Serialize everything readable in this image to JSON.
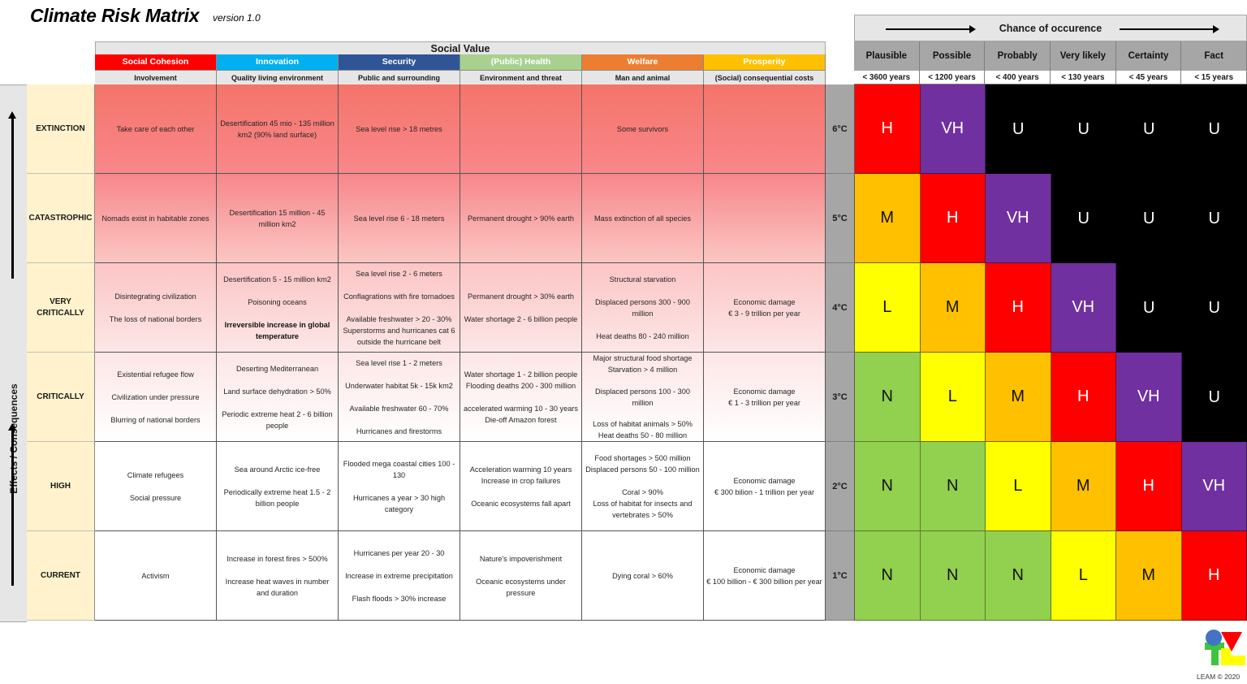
{
  "header": {
    "title": "Climate Risk Matrix",
    "version": "version 1.0"
  },
  "social_value": {
    "title": "Social Value",
    "categories": [
      {
        "label": "Social Cohesion",
        "subtitle": "Involvement",
        "color": "#ff0000"
      },
      {
        "label": "Innovation",
        "subtitle": "Quality living environment",
        "color": "#00b0f0"
      },
      {
        "label": "Security",
        "subtitle": "Public and surrounding",
        "color": "#2f5597"
      },
      {
        "label": "(Public) Health",
        "subtitle": "Environment and threat",
        "color": "#a9d08e"
      },
      {
        "label": "Welfare",
        "subtitle": "Man and animal",
        "color": "#ed7d31"
      },
      {
        "label": "Prosperity",
        "subtitle": "(Social) consequential costs",
        "color": "#ffc000"
      }
    ]
  },
  "axis": {
    "label": "Effects / Consequences"
  },
  "levels": [
    "EXTINCTION",
    "CATASTROPHIC",
    "VERY CRITICALLY",
    "CRITICALLY",
    "HIGH",
    "CURRENT"
  ],
  "temperatures": [
    "6°C",
    "5°C",
    "4°C",
    "3°C",
    "2°C",
    "1°C"
  ],
  "effects": [
    [
      [
        [
          "Take care of each other"
        ]
      ],
      [
        [
          "Desertification 45 mio - 135 million km2 (90% land surface)"
        ]
      ],
      [
        [
          "Sea level rise > 18 metres"
        ]
      ],
      [],
      [
        [
          "Some survivors"
        ]
      ],
      []
    ],
    [
      [
        [
          "Nomads exist in habitable zones"
        ]
      ],
      [
        [
          "Desertification 15 million - 45 million km2"
        ]
      ],
      [
        [
          "Sea level rise 6 - 18 meters"
        ]
      ],
      [
        [
          "Permanent drought > 90% earth"
        ]
      ],
      [
        [
          "Mass extinction of all species"
        ]
      ],
      []
    ],
    [
      [
        [
          "Disintegrating civilization"
        ],
        [
          "The loss of national borders"
        ]
      ],
      [
        [
          "Desertification 5 - 15 million km2"
        ],
        [
          "Poisoning oceans"
        ],
        [
          "Irreversible increase in global temperature",
          "bold"
        ]
      ],
      [
        [
          "Sea level rise 2 - 6 meters"
        ],
        [
          "Conflagrations with fire tornadoes"
        ],
        [
          "Available freshwater > 20 - 30%",
          "",
          "Superstorms and hurricanes cat 6 outside the hurricane belt"
        ]
      ],
      [
        [
          "Permanent drought > 30% earth"
        ],
        [
          "Water shortage 2 - 6 billion people"
        ]
      ],
      [
        [
          "Structural starvation"
        ],
        [
          "Displaced persons 300 - 900 million"
        ],
        [
          "Heat deaths 80 - 240 million"
        ]
      ],
      [
        [
          "Economic damage",
          "",
          "€ 3 - 9 trillion per year"
        ]
      ]
    ],
    [
      [
        [
          "Existential refugee flow"
        ],
        [
          "Civilization under pressure"
        ],
        [
          "Blurring of national borders"
        ]
      ],
      [
        [
          "Deserting Mediterranean"
        ],
        [
          "Land surface dehydration > 50%"
        ],
        [
          "Periodic extreme heat 2 - 6 billion people"
        ]
      ],
      [
        [
          "Sea level rise 1 - 2 meters"
        ],
        [
          "Underwater habitat 5k - 15k km2"
        ],
        [
          "Available freshwater 60 - 70%"
        ],
        [
          "Hurricanes and firestorms"
        ]
      ],
      [
        [
          "Water shortage 1 - 2 billion people",
          "",
          "Flooding deaths 200 - 300 million"
        ],
        [
          "accelerated warming 10 - 30 years",
          "",
          "Die-off Amazon forest"
        ]
      ],
      [
        [
          "Major structural food shortage",
          "",
          "Starvation > 4 million"
        ],
        [
          "Displaced persons 100 - 300 million"
        ],
        [
          "Loss of habitat animals > 50%",
          "",
          "Heat deaths 50 - 80 million"
        ]
      ],
      [
        [
          "Economic damage",
          "",
          "€ 1 - 3 trillion per year"
        ]
      ]
    ],
    [
      [
        [
          "Climate refugees"
        ],
        [
          "Social pressure"
        ]
      ],
      [
        [
          "Sea around Arctic ice-free"
        ],
        [
          "Periodically extreme heat 1.5 - 2 billion people"
        ]
      ],
      [
        [
          "Flooded mega coastal cities 100 - 130"
        ],
        [
          "Hurricanes a year > 30 high category"
        ]
      ],
      [
        [
          "Acceleration warming 10 years",
          "",
          "Increase in crop failures"
        ],
        [
          "Oceanic ecosystems fall apart"
        ]
      ],
      [
        [
          "Food shortages > 500 million",
          "",
          "Displaced persons 50 - 100 million"
        ],
        [
          "Coral > 90%",
          "",
          "Loss of habitat for insects and vertebrates > 50%"
        ]
      ],
      [
        [
          "Economic damage",
          "",
          "€ 300 bilion - 1 trillion per year"
        ]
      ]
    ],
    [
      [
        [
          "Activism"
        ]
      ],
      [
        [
          "Increase in forest fires > 500%"
        ],
        [
          "Increase heat waves in number and duration"
        ]
      ],
      [
        [
          "Hurricanes per year 20 - 30"
        ],
        [
          "Increase in extreme precipitation"
        ],
        [
          "Flash floods > 30% increase"
        ]
      ],
      [
        [
          "Nature's impoverishment"
        ],
        [
          "Oceanic ecosystems under pressure"
        ]
      ],
      [
        [
          "Dying coral > 60%"
        ]
      ],
      [
        [
          "Economic damage",
          "",
          "€ 100 billion -  € 300 billion per year"
        ]
      ]
    ]
  ],
  "chance": {
    "title": "Chance of occurence",
    "columns": [
      {
        "label": "Plausible",
        "years": "< 3600 years"
      },
      {
        "label": "Possible",
        "years": "< 1200 years"
      },
      {
        "label": "Probably",
        "years": "< 400 years"
      },
      {
        "label": "Very likely",
        "years": "< 130 years"
      },
      {
        "label": "Certainty",
        "years": "< 45 years"
      },
      {
        "label": "Fact",
        "years": "< 15 years"
      }
    ]
  },
  "risk_matrix": [
    [
      "H",
      "VH",
      "U",
      "U",
      "U",
      "U"
    ],
    [
      "M",
      "H",
      "VH",
      "U",
      "U",
      "U"
    ],
    [
      "L",
      "M",
      "H",
      "VH",
      "U",
      "U"
    ],
    [
      "N",
      "L",
      "M",
      "H",
      "VH",
      "U"
    ],
    [
      "N",
      "N",
      "L",
      "M",
      "H",
      "VH"
    ],
    [
      "N",
      "N",
      "N",
      "L",
      "M",
      "H"
    ]
  ],
  "risk_colors": {
    "N": "#92d050",
    "L": "#ffff00",
    "M": "#ffc000",
    "H": "#ff0000",
    "VH": "#7030a0",
    "U": "#000000"
  },
  "footer": {
    "copyright": "LEAM © 2020"
  }
}
